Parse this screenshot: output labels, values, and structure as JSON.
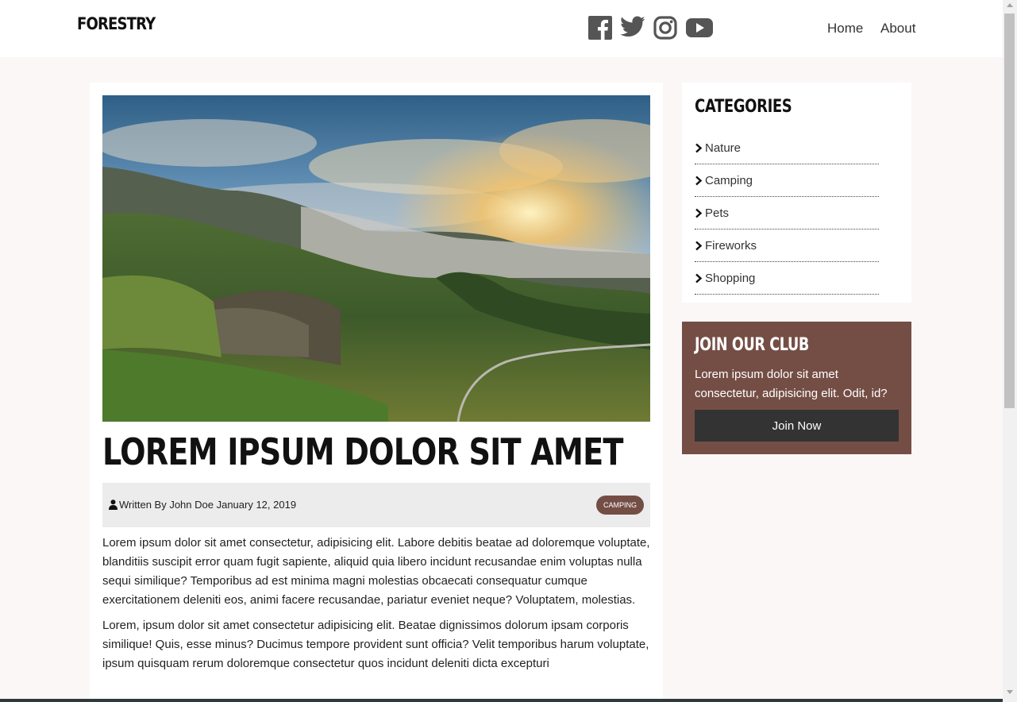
{
  "header": {
    "logo": "FORESTRY",
    "social": [
      "facebook-icon",
      "twitter-icon",
      "instagram-icon",
      "youtube-icon"
    ],
    "nav": [
      {
        "label": "Home"
      },
      {
        "label": "About"
      }
    ]
  },
  "article": {
    "title": "LOREM IPSUM DOLOR SIT AMET",
    "meta": "Written By John Doe January 12, 2019",
    "category_badge": "CAMPING",
    "paragraphs": [
      "Lorem ipsum dolor sit amet consectetur, adipisicing elit. Labore debitis beatae ad doloremque voluptate, blanditiis suscipit error quam fugit sapiente, aliquid quia libero incidunt recusandae enim voluptas nulla sequi similique? Temporibus ad est minima magni molestias obcaecati consequatur cumque exercitationem deleniti eos, animi facere recusandae, pariatur eveniet neque? Voluptatem, molestias.",
      "Lorem, ipsum dolor sit amet consectetur adipisicing elit. Beatae dignissimos dolorum ipsam corporis similique! Quis, esse minus? Ducimus tempore provident sunt officia? Velit temporibus harum voluptate, ipsum quisquam rerum doloremque consectetur quos incidunt deleniti dicta excepturi"
    ]
  },
  "sidebar": {
    "categories_heading": "CATEGORIES",
    "categories": [
      {
        "label": "Nature"
      },
      {
        "label": "Camping"
      },
      {
        "label": "Pets"
      },
      {
        "label": "Fireworks"
      },
      {
        "label": "Shopping"
      }
    ],
    "club": {
      "heading": "JOIN OUR CLUB",
      "text": "Lorem ipsum dolor sit amet consectetur, adipisicing elit. Odit, id?",
      "button": "Join Now"
    }
  },
  "colors": {
    "accent": "#744e45",
    "button": "#333333",
    "page_bg": "#fbf7f7"
  }
}
